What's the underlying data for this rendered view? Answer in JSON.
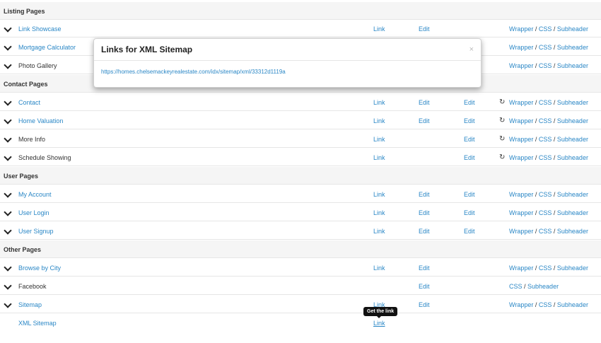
{
  "sections": {
    "listing": "Listing Pages",
    "contact": "Contact Pages",
    "user": "User Pages",
    "other": "Other Pages"
  },
  "rows": {
    "link_showcase": "Link Showcase",
    "mortgage_calculator": "Mortgage Calculator",
    "photo_gallery": "Photo Gallery",
    "contact": "Contact",
    "home_valuation": "Home Valuation",
    "more_info": "More Info",
    "schedule_showing": "Schedule Showing",
    "my_account": "My Account",
    "user_login": "User Login",
    "user_signup": "User Signup",
    "browse_by_city": "Browse by City",
    "facebook": "Facebook",
    "sitemap": "Sitemap",
    "xml_sitemap": "XML Sitemap"
  },
  "labels": {
    "link": "Link",
    "edit": "Edit",
    "wrapper": "Wrapper",
    "css": "CSS",
    "subheader": "Subheader",
    "slash": " / "
  },
  "modal": {
    "title": "Links for XML Sitemap",
    "close": "×",
    "url": "https://homes.chelsemackeyrealestate.com/idx/sitemap/xml/33312d1119a"
  },
  "tooltip": "Get the link",
  "icons": {
    "chevron": "chevron-down-icon",
    "sync": "sync-icon"
  }
}
